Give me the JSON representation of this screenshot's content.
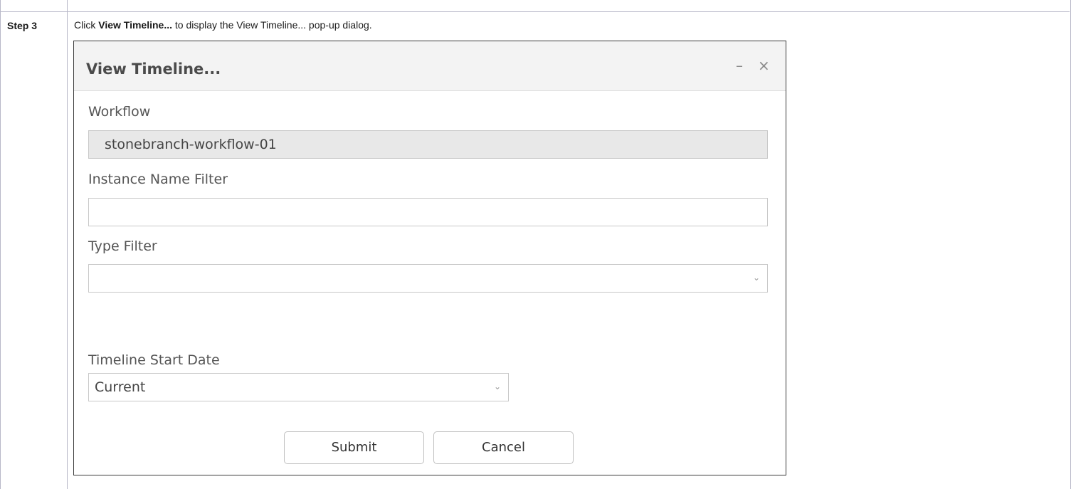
{
  "step": {
    "label": "Step 3"
  },
  "instruction": {
    "prefix": "Click ",
    "bold": "View Timeline...",
    "suffix": " to display the View Timeline... pop-up dialog."
  },
  "dialog": {
    "title": "View Timeline...",
    "minimize_symbol": "–",
    "close_symbol": "×",
    "fields": {
      "workflow_label": "Workflow",
      "workflow_value": "stonebranch-workflow-01",
      "instance_name_filter_label": "Instance Name Filter",
      "instance_name_filter_value": "",
      "type_filter_label": "Type Filter",
      "type_filter_value": "",
      "timeline_start_date_label": "Timeline Start Date",
      "timeline_start_date_value": "Current"
    },
    "chevron_symbol": "⌄",
    "buttons": {
      "submit": "Submit",
      "cancel": "Cancel"
    }
  },
  "icons": {
    "minimize": "minimize-icon",
    "close": "close-icon",
    "dropdown": "chevron-down-icon"
  }
}
